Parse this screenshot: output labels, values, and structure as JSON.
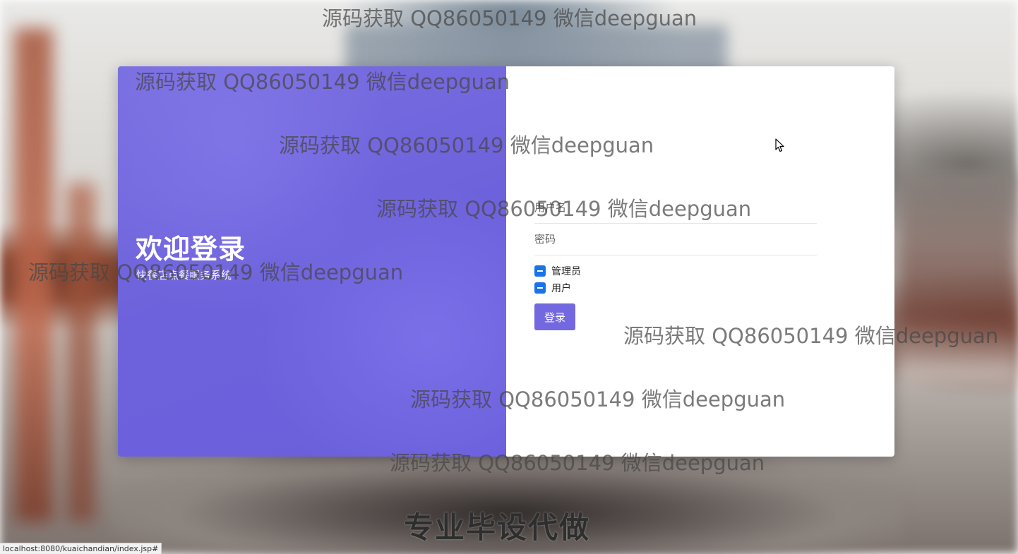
{
  "login": {
    "welcome_title": "欢迎登录",
    "system_name": "快餐店点餐服务系统",
    "username_placeholder": "用户名",
    "password_placeholder": "密码",
    "roles": [
      {
        "label": "管理员",
        "checked": true
      },
      {
        "label": "用户",
        "checked": true
      }
    ],
    "login_button": "登录"
  },
  "watermark": {
    "text": "源码获取 QQ86050149 微信deepguan",
    "promo": "专业毕设代做"
  },
  "status_bar": {
    "url": "localhost:8080/kuaichandian/index.jsp#"
  },
  "colors": {
    "panel_purple": "#6e62dc",
    "button_purple": "#7468e0",
    "checkbox_blue": "#1a73e8"
  }
}
